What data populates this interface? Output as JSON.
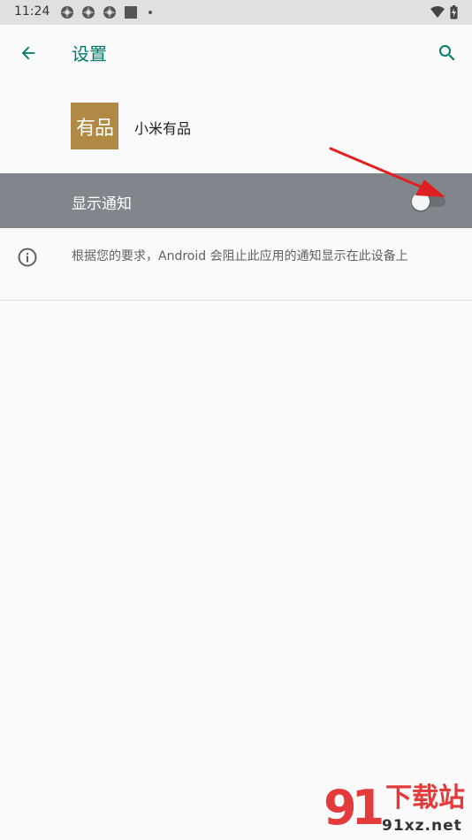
{
  "status_bar": {
    "time": "11:24"
  },
  "app_bar": {
    "title": "设置",
    "back_icon": "arrow-back-icon",
    "search_icon": "search-icon"
  },
  "app": {
    "logo_text": "有品",
    "name": "小米有品"
  },
  "notification": {
    "label": "显示通知",
    "enabled": false
  },
  "info": {
    "text": "根据您的要求，Android 会阻止此应用的通知显示在此设备上"
  },
  "watermark": {
    "number": "91",
    "title": "下载站",
    "domain": "91xz.net"
  },
  "colors": {
    "accent": "#00796b",
    "toggle_row_bg": "#80868b",
    "logo_bg": "#b08a45",
    "annotation": "#e02020"
  }
}
